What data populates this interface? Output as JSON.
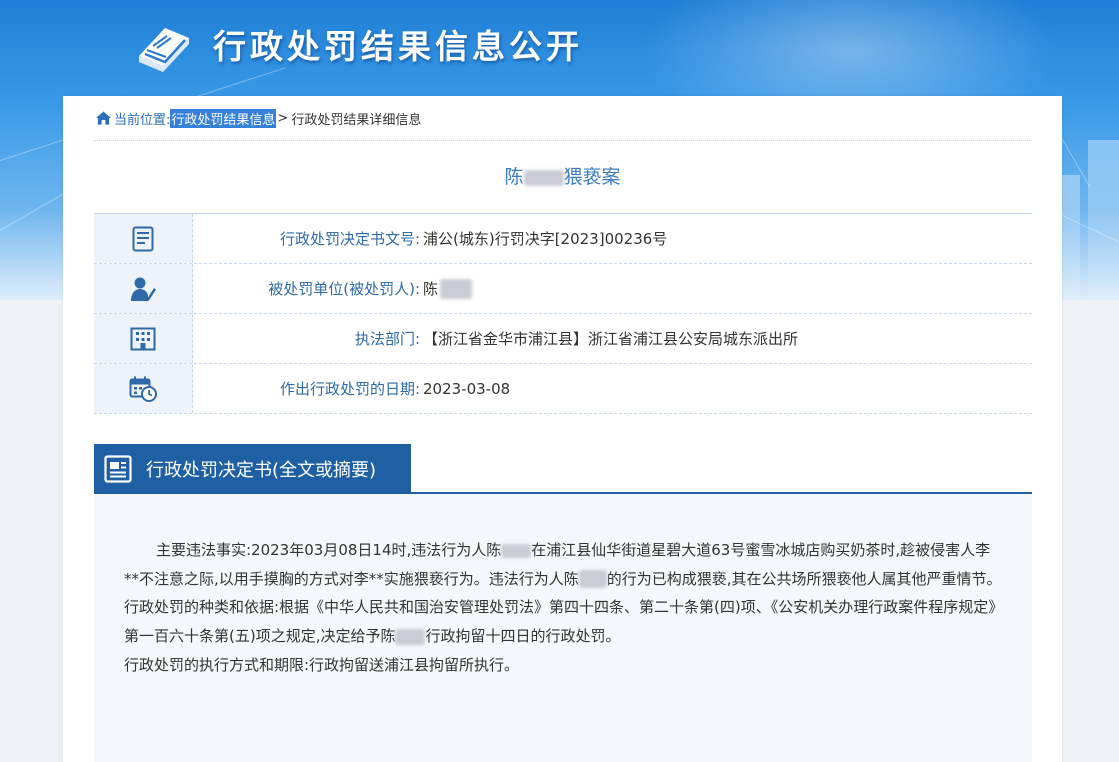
{
  "header": {
    "site_title": "行政处罚结果信息公开",
    "logo_icon": "book-icon"
  },
  "breadcrumb": {
    "home_icon": "home-icon",
    "current_label": "当前位置:",
    "link": "行政处罚结果信息",
    "separator": ">",
    "current": "行政处罚结果详细信息"
  },
  "case": {
    "title_prefix": "陈",
    "title_suffix": "猥亵案"
  },
  "info": [
    {
      "icon": "document-list-icon",
      "label": "行政处罚决定书文号:",
      "value": "浦公(城东)行罚决字[2023]00236号"
    },
    {
      "icon": "person-pen-icon",
      "label": "被处罚单位(被处罚人):",
      "value": "陈"
    },
    {
      "icon": "building-icon",
      "label": "执法部门:",
      "value": "【浙江省金华市浦江县】浙江省浦江县公安局城东派出所"
    },
    {
      "icon": "calendar-clock-icon",
      "label": "作出行政处罚的日期:",
      "value": "2023-03-08"
    }
  ],
  "section": {
    "icon": "document-icon",
    "title": "行政处罚决定书(全文或摘要)"
  },
  "content": {
    "p1_a": "主要违法事实:2023年03月08日14时,违法行为人陈",
    "p1_b": "在浦江县仙华街道星碧大道63号蜜雪冰城店购买奶茶时,趁被侵害人李**不注意之际,以用手摸胸的方式对李**实施猥亵行为。违法行为人陈",
    "p1_c": "的行为已构成猥亵,其在公共场所猥亵他人属其他严重情节。",
    "p2_a": "行政处罚的种类和依据:根据《中华人民共和国治安管理处罚法》第四十四条、第二十条第(四)项、《公安机关办理行政案件程序规定》第一百六十条第(五)项之规定,决定给予陈",
    "p2_b": "行政拘留十四日的行政处罚。",
    "p3": "行政处罚的执行方式和期限:行政拘留送浦江县拘留所执行。"
  },
  "colors": {
    "primary": "#1f5fa3",
    "label_blue": "#2e6aa8",
    "title_blue": "#3a7cc2",
    "breadcrumb_highlight": "#3580d8"
  }
}
